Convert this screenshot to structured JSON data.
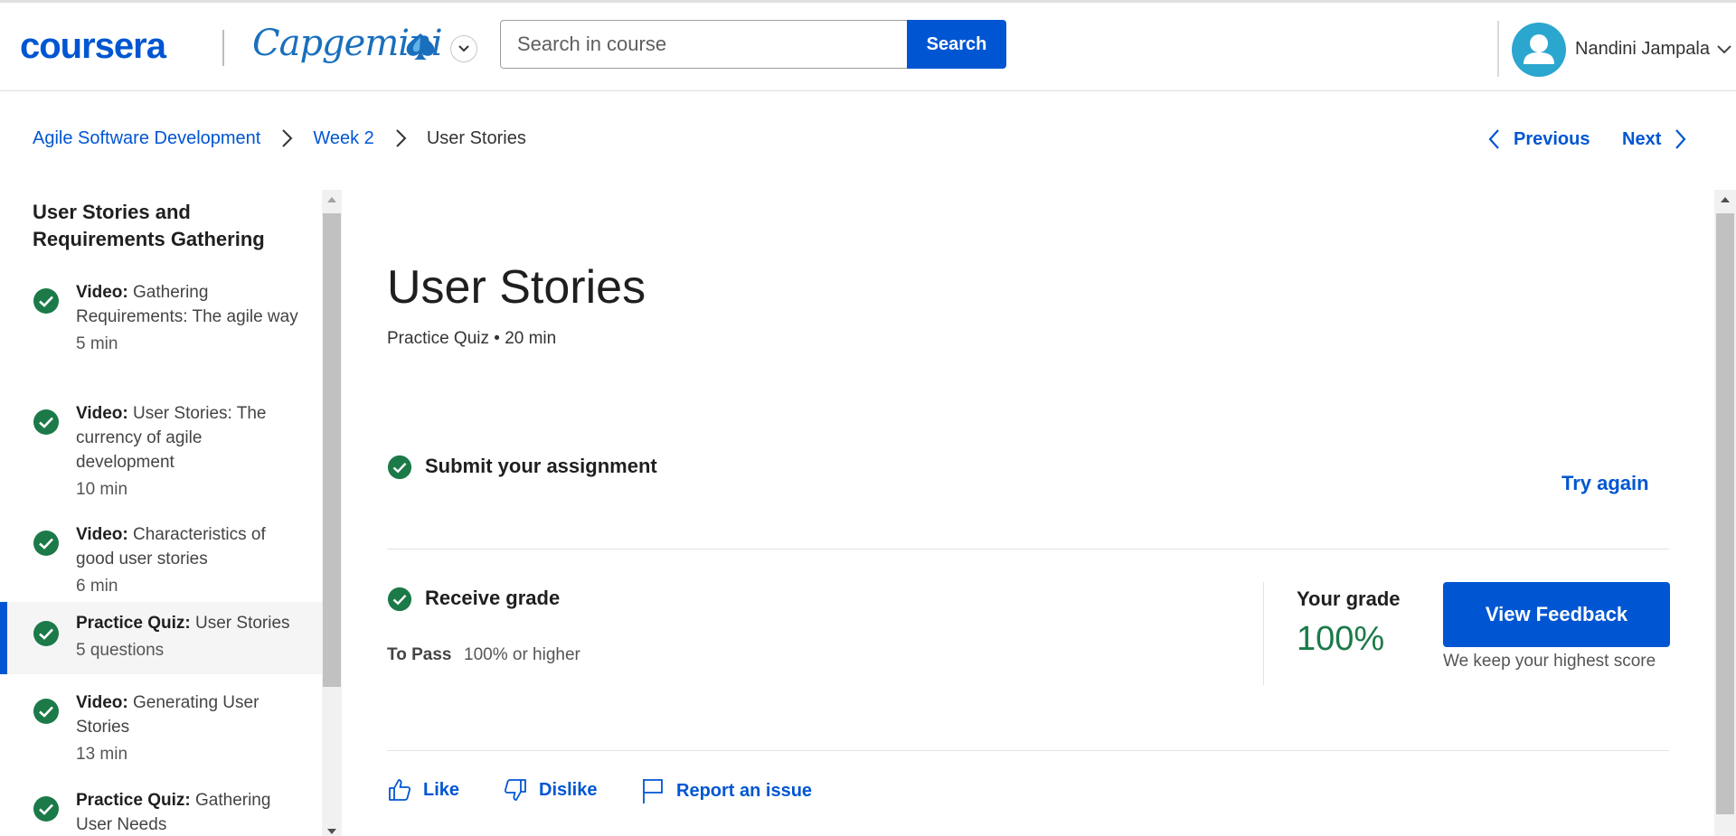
{
  "header": {
    "brand": "coursera",
    "partner": "Capgemini",
    "search_placeholder": "Search in course",
    "search_button": "Search",
    "user_name": "Nandini Jampala"
  },
  "breadcrumb": {
    "course": "Agile Software Development",
    "week": "Week 2",
    "current": "User Stories"
  },
  "nav": {
    "previous": "Previous",
    "next": "Next"
  },
  "sidebar": {
    "section_title": "User Stories and Requirements Gathering",
    "items": [
      {
        "type": "Video:",
        "title": "Gathering Requirements: The agile way",
        "meta": "5 min",
        "completed": true
      },
      {
        "type": "Video:",
        "title": "User Stories: The currency of agile development",
        "meta": "10 min",
        "completed": true
      },
      {
        "type": "Video:",
        "title": "Characteristics of good user stories",
        "meta": "6 min",
        "completed": true
      },
      {
        "type": "Practice Quiz:",
        "title": "User Stories",
        "meta": "5 questions",
        "completed": true,
        "active": true
      },
      {
        "type": "Video:",
        "title": "Generating User Stories",
        "meta": "13 min",
        "completed": true
      },
      {
        "type": "Practice Quiz:",
        "title": "Gathering User Needs",
        "meta": "",
        "completed": true
      }
    ]
  },
  "main": {
    "title": "User Stories",
    "subtitle": "Practice Quiz • 20 min",
    "submit_label": "Submit your assignment",
    "try_again": "Try again",
    "receive_label": "Receive grade",
    "to_pass_label": "To Pass",
    "to_pass_value": "100% or higher",
    "your_grade_label": "Your grade",
    "grade_value": "100%",
    "feedback_button": "View Feedback",
    "feedback_note": "We keep your highest score"
  },
  "actions": {
    "like": "Like",
    "dislike": "Dislike",
    "report": "Report an issue"
  },
  "colors": {
    "accent": "#0056d2",
    "success": "#1b7a48",
    "partner": "#1a6fbd",
    "avatar_bg": "#2aa6cf"
  }
}
